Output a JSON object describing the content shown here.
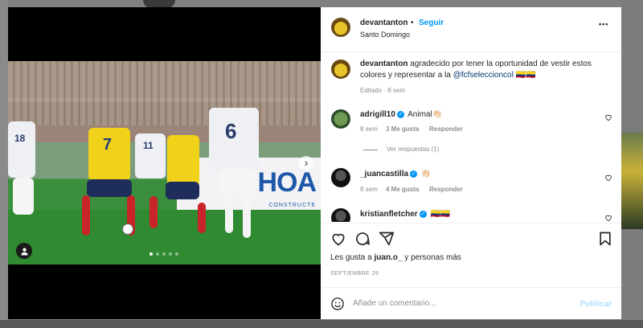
{
  "post": {
    "username": "devantanton",
    "separator": "•",
    "follow_label": "Seguir",
    "location": "Santo Domingo",
    "more_label": "•••",
    "caption": {
      "username": "devantanton",
      "text": "agradecido por tener la oportunidad de vestir estos colores y representar a la",
      "mention": "@fcfseleccioncol",
      "emoji": "🇨🇴🇨🇴"
    },
    "caption_meta": "Editado · 8 sem",
    "photo": {
      "banner_text": "OHOA",
      "banner_sub": "CONSTRUCTE",
      "jersey_numbers": [
        "7",
        "11",
        "6",
        "18"
      ],
      "carousel": {
        "count": 5,
        "active": 0
      }
    }
  },
  "comments": [
    {
      "username": "adrigill10",
      "verified": true,
      "text": "Animal👏🏻",
      "time": "8 sem",
      "likes": "3 Me gusta",
      "reply": "Responder"
    },
    {
      "username": "_juancastilla",
      "verified": true,
      "text": "👏🏻",
      "time": "8 sem",
      "likes": "4 Me gusta",
      "reply": "Responder"
    },
    {
      "username": "kristianfletcher",
      "verified": true,
      "text": "🇨🇴🇨🇴"
    }
  ],
  "replies_label": "Ver respuestas (1)",
  "likes": {
    "prefix": "Les gusta a",
    "user": "juan.o_",
    "suffix": "y personas más"
  },
  "date": "SEPTIEMBRE 29",
  "comment_box": {
    "placeholder": "Añade un comentario...",
    "publish_label": "Publicar"
  },
  "colors": {
    "accent": "#0095f6",
    "mention": "#00376b",
    "secondary_text": "#8e8e8e"
  },
  "icons": [
    "heart-icon",
    "comment-icon",
    "share-icon",
    "bookmark-icon",
    "emoji-icon",
    "user-tag-icon",
    "next-arrow-icon",
    "verified-icon",
    "more-icon"
  ]
}
